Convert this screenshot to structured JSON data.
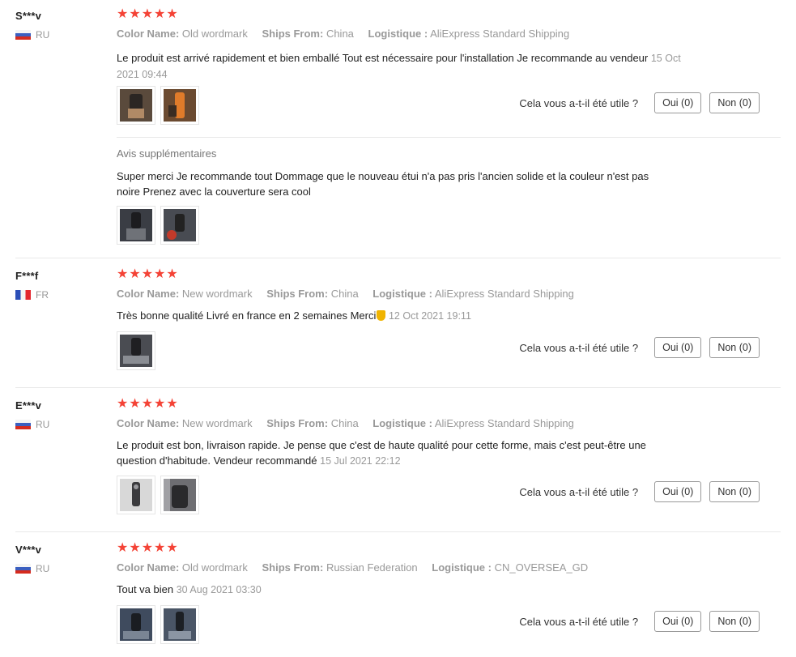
{
  "labels": {
    "color_name": "Color Name:",
    "ships_from": "Ships From:",
    "logistique": "Logistique :",
    "helpful_question": "Cela vous a-t-il été utile ?",
    "additional_reviews": "Avis supplémentaires"
  },
  "colors": {
    "star": "#f44336",
    "muted": "#999999",
    "border": "#e8e8e8"
  },
  "reviews": [
    {
      "user": "S***v",
      "country": "RU",
      "flag": "ru-flag-icon",
      "stars": "★★★★★",
      "color_name": "Old wordmark",
      "ships_from": "China",
      "logistique": "AliExpress Standard Shipping",
      "text": "Le produit est arrivé rapidement et bien emballé Tout est nécessaire pour l'installation Je recommande au vendeur",
      "date": "15 Oct 2021 09:44",
      "yes": "Oui (0)",
      "no": "Non (0)",
      "additional_text": "Super merci Je recommande tout Dommage que le nouveau étui n'a pas pris l'ancien solide et la couleur n'est pas noire Prenez avec la couverture sera cool"
    },
    {
      "user": "F***f",
      "country": "FR",
      "flag": "fr-flag-icon",
      "stars": "★★★★★",
      "color_name": "New wordmark",
      "ships_from": "China",
      "logistique": "AliExpress Standard Shipping",
      "text": "Très bonne qualité Livré en france en 2 semaines Merci",
      "date": "12 Oct 2021 19:11",
      "yes": "Oui (0)",
      "no": "Non (0)"
    },
    {
      "user": "E***v",
      "country": "RU",
      "flag": "ru-flag-icon",
      "stars": "★★★★★",
      "color_name": "New wordmark",
      "ships_from": "China",
      "logistique": "AliExpress Standard Shipping",
      "text": "Le produit est bon, livraison rapide. Je pense que c'est de haute qualité pour cette forme, mais c'est peut-être une question d'habitude. Vendeur recommandé",
      "date": "15 Jul 2021 22:12",
      "yes": "Oui (0)",
      "no": "Non (0)"
    },
    {
      "user": "V***v",
      "country": "RU",
      "flag": "ru-flag-icon",
      "stars": "★★★★★",
      "color_name": "Old wordmark",
      "ships_from": "Russian Federation",
      "logistique": "CN_OVERSEA_GD",
      "text": "Tout va bien",
      "date": "30 Aug 2021 03:30",
      "yes": "Oui (0)",
      "no": "Non (0)"
    }
  ]
}
